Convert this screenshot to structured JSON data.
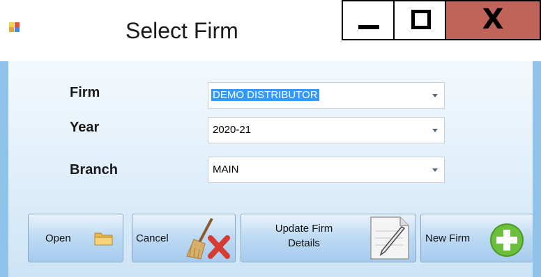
{
  "window": {
    "title": "Select Firm"
  },
  "form": {
    "firm": {
      "label": "Firm",
      "value": "DEMO DISTRIBUTOR"
    },
    "year": {
      "label": "Year",
      "value": "2020-21"
    },
    "branch": {
      "label": "Branch",
      "value": "MAIN"
    }
  },
  "buttons": {
    "open": "Open",
    "cancel": "Cancel",
    "update_line1": "Update Firm",
    "update_line2": "Details",
    "new_firm": "New Firm"
  },
  "icons": {
    "app": "app-icon",
    "open": "folder-icon",
    "cancel": "broom-x-icon",
    "update": "notepad-pencil-icon",
    "new_firm": "plus-circle-icon"
  },
  "colors": {
    "close_button": "#c0635a",
    "selection": "#3399ff",
    "add_green": "#6cbf3a"
  }
}
